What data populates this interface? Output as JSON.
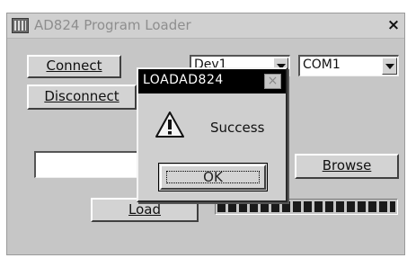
{
  "window": {
    "title": "AD824 Program Loader",
    "close_glyph": "×"
  },
  "buttons": {
    "connect": "Connect",
    "disconnect": "Disconnect",
    "browse": "Browse",
    "load": "Load"
  },
  "device_select": {
    "value": "Dev1"
  },
  "port_select": {
    "value": "COM1"
  },
  "file_path": {
    "value": ""
  },
  "progress": {
    "fraction": 1.0
  },
  "dialog": {
    "title": "LOADAD824",
    "close_glyph": "×",
    "message": "Success",
    "ok_label": "OK",
    "icon": "warning-icon"
  }
}
